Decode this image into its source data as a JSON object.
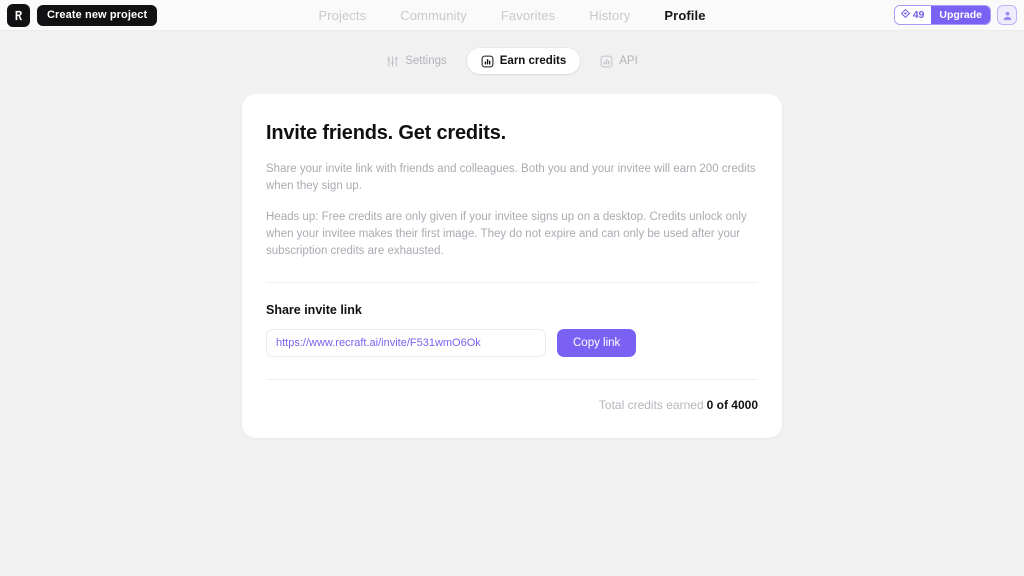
{
  "topbar": {
    "logo_icon": "recraft-logo-icon",
    "new_project_label": "Create new project",
    "nav": [
      {
        "label": "Projects",
        "active": false
      },
      {
        "label": "Community",
        "active": false
      },
      {
        "label": "Favorites",
        "active": false
      },
      {
        "label": "History",
        "active": false
      },
      {
        "label": "Profile",
        "active": true
      }
    ],
    "credits": {
      "icon": "gem-icon",
      "value": "49"
    },
    "upgrade_label": "Upgrade",
    "avatar_icon": "user-avatar-icon"
  },
  "tabs": [
    {
      "label": "Settings",
      "icon": "sliders-icon",
      "active": false
    },
    {
      "label": "Earn credits",
      "icon": "bar-chart-box-icon",
      "active": true
    },
    {
      "label": "API",
      "icon": "bar-chart-box-icon",
      "active": false
    }
  ],
  "card": {
    "heading": "Invite friends. Get credits.",
    "paragraph_1": "Share your invite link with friends and colleagues. Both you and your invitee will earn 200 credits when they sign up.",
    "paragraph_2": "Heads up: Free credits are only given if your invitee signs up on a desktop. Credits unlock only when your invitee makes their first image. They do not expire and can only be used after your subscription credits are exhausted.",
    "share_section_title": "Share invite link",
    "invite_link_value": "https://www.recraft.ai/invite/F531wmO6Ok",
    "invite_link_placeholder": "https://www.recraft.ai/invite/",
    "copy_button_label": "Copy link",
    "total_credits_label": "Total credits earned",
    "total_credits_value": "0 of 4000"
  },
  "colors": {
    "accent": "#7b61f3",
    "page_background": "#f1f1f1",
    "card_background": "#ffffff",
    "muted_text": "#aaaab2",
    "dark": "#111113"
  }
}
